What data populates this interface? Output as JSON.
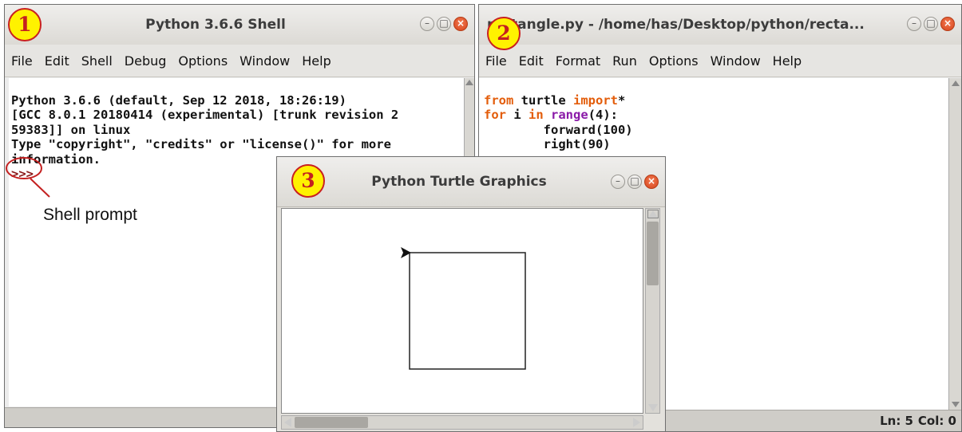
{
  "badges": [
    "1",
    "2",
    "3"
  ],
  "shell": {
    "title": "Python 3.6.6 Shell",
    "menu": [
      "File",
      "Edit",
      "Shell",
      "Debug",
      "Options",
      "Window",
      "Help"
    ],
    "lines": [
      "Python 3.6.6 (default, Sep 12 2018, 18:26:19)",
      "[GCC 8.0.1 20180414 (experimental) [trunk revision 2",
      "59383]] on linux",
      "Type \"copyright\", \"credits\" or \"license()\" for more",
      "information."
    ],
    "prompt": ">>>",
    "annotation": "Shell prompt"
  },
  "editor": {
    "title": "rectangle.py - /home/has/Desktop/python/recta...",
    "menu": [
      "File",
      "Edit",
      "Format",
      "Run",
      "Options",
      "Window",
      "Help"
    ],
    "code": {
      "line1": [
        "from",
        " turtle ",
        "import",
        "*"
      ],
      "line2": [
        "for",
        " i ",
        "in",
        " ",
        "range",
        "(4):"
      ],
      "line3": "        forward(100)",
      "line4": "        right(90)"
    },
    "status": {
      "ln": "Ln: 5",
      "col": "Col: 0"
    }
  },
  "turtle": {
    "title": "Python Turtle Graphics"
  },
  "window_buttons": {
    "minimize": "–",
    "maximize": "□",
    "close": "×"
  },
  "colors": {
    "badge_fill": "#fff200",
    "badge_ring": "#c92020",
    "keyword": "#e35d0b",
    "builtin": "#8a1aa8",
    "annotation": "#c42020"
  }
}
